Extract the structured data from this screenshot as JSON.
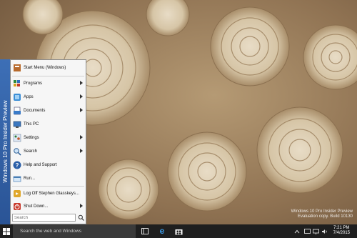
{
  "desktop": {
    "watermark_line1": "Windows 10 Pro Insider Preview",
    "watermark_line2": "Evaluation copy. Build 10130"
  },
  "start_menu": {
    "brand": "Windows 10 Pro Insider Preview",
    "items": [
      {
        "label": "Start Menu (Windows)",
        "icon": "start-menu-icon",
        "submenu": false
      },
      {
        "label": "Programs",
        "icon": "programs-icon",
        "submenu": true
      },
      {
        "label": "Apps",
        "icon": "apps-icon",
        "submenu": true
      },
      {
        "label": "Documents",
        "icon": "documents-icon",
        "submenu": true
      },
      {
        "label": "This PC",
        "icon": "computer-icon",
        "submenu": false
      },
      {
        "label": "Settings",
        "icon": "settings-icon",
        "submenu": true
      },
      {
        "label": "Search",
        "icon": "search-icon",
        "submenu": true
      },
      {
        "label": "Help and Support",
        "icon": "help-icon",
        "submenu": false
      },
      {
        "label": "Run...",
        "icon": "run-icon",
        "submenu": false
      },
      {
        "label": "Log Off Stephen Glasskeys...",
        "icon": "logoff-icon",
        "submenu": false
      },
      {
        "label": "Shut Down...",
        "icon": "shutdown-icon",
        "submenu": true
      }
    ],
    "search_placeholder": "Search"
  },
  "taskbar": {
    "search_placeholder": "Search the web and Windows",
    "time": "7:21 PM",
    "date": "7/4/2015",
    "colors": {
      "bar": "#1f1f1f",
      "accent": "#2a5496"
    }
  }
}
